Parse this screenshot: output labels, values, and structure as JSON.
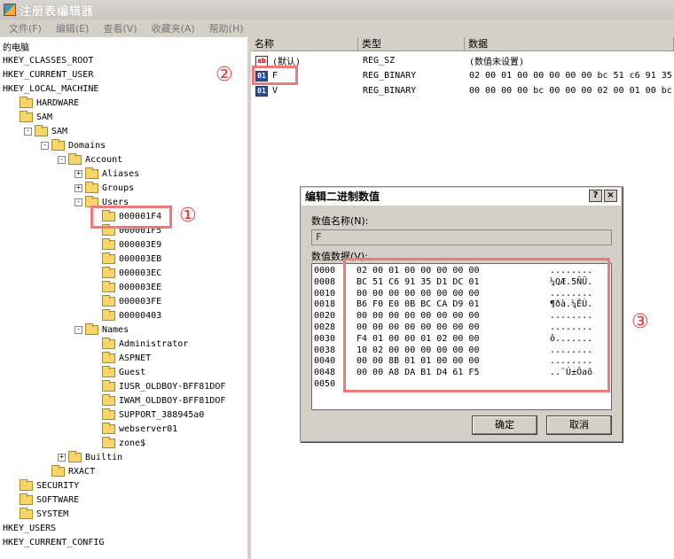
{
  "window": {
    "title": "注册表编辑器"
  },
  "menu": [
    "文件(F)",
    "编辑(E)",
    "查看(V)",
    "收藏夹(A)",
    "帮助(H)"
  ],
  "tree": [
    {
      "label": "的电脑",
      "level": 0,
      "exp": "",
      "icon": false
    },
    {
      "label": "HKEY_CLASSES_ROOT",
      "level": 0,
      "exp": "",
      "icon": false
    },
    {
      "label": "HKEY_CURRENT_USER",
      "level": 0,
      "exp": "",
      "icon": false
    },
    {
      "label": "HKEY_LOCAL_MACHINE",
      "level": 0,
      "exp": "",
      "icon": false
    },
    {
      "label": "HARDWARE",
      "level": 1,
      "exp": "",
      "icon": true
    },
    {
      "label": "SAM",
      "level": 1,
      "exp": "",
      "icon": true
    },
    {
      "label": "SAM",
      "level": 2,
      "exp": "-",
      "icon": true
    },
    {
      "label": "Domains",
      "level": 3,
      "exp": "-",
      "icon": true
    },
    {
      "label": "Account",
      "level": 4,
      "exp": "-",
      "icon": true
    },
    {
      "label": "Aliases",
      "level": 5,
      "exp": "+",
      "icon": true
    },
    {
      "label": "Groups",
      "level": 5,
      "exp": "+",
      "icon": true
    },
    {
      "label": "Users",
      "level": 5,
      "exp": "-",
      "icon": true
    },
    {
      "label": "000001F4",
      "level": 6,
      "exp": "",
      "icon": true
    },
    {
      "label": "000001F5",
      "level": 6,
      "exp": "",
      "icon": true
    },
    {
      "label": "000003E9",
      "level": 6,
      "exp": "",
      "icon": true
    },
    {
      "label": "000003EB",
      "level": 6,
      "exp": "",
      "icon": true
    },
    {
      "label": "000003EC",
      "level": 6,
      "exp": "",
      "icon": true
    },
    {
      "label": "000003EE",
      "level": 6,
      "exp": "",
      "icon": true
    },
    {
      "label": "000003FE",
      "level": 6,
      "exp": "",
      "icon": true
    },
    {
      "label": "00000403",
      "level": 6,
      "exp": "",
      "icon": true
    },
    {
      "label": "Names",
      "level": 5,
      "exp": "-",
      "icon": true
    },
    {
      "label": "Administrator",
      "level": 6,
      "exp": "",
      "icon": true
    },
    {
      "label": "ASPNET",
      "level": 6,
      "exp": "",
      "icon": true
    },
    {
      "label": "Guest",
      "level": 6,
      "exp": "",
      "icon": true
    },
    {
      "label": "IUSR_OLDBOY-BFF81DOF",
      "level": 6,
      "exp": "",
      "icon": true
    },
    {
      "label": "IWAM_OLDBOY-BFF81DOF",
      "level": 6,
      "exp": "",
      "icon": true
    },
    {
      "label": "SUPPORT_388945a0",
      "level": 6,
      "exp": "",
      "icon": true
    },
    {
      "label": "webserver01",
      "level": 6,
      "exp": "",
      "icon": true
    },
    {
      "label": "zone$",
      "level": 6,
      "exp": "",
      "icon": true
    },
    {
      "label": "Builtin",
      "level": 4,
      "exp": "+",
      "icon": true
    },
    {
      "label": "RXACT",
      "level": 3,
      "exp": "",
      "icon": true
    },
    {
      "label": "SECURITY",
      "level": 1,
      "exp": "",
      "icon": true
    },
    {
      "label": "SOFTWARE",
      "level": 1,
      "exp": "",
      "icon": true
    },
    {
      "label": "SYSTEM",
      "level": 1,
      "exp": "",
      "icon": true
    },
    {
      "label": "HKEY_USERS",
      "level": 0,
      "exp": "",
      "icon": false
    },
    {
      "label": "HKEY_CURRENT_CONFIG",
      "level": 0,
      "exp": "",
      "icon": false
    }
  ],
  "list": {
    "headers": [
      "名称",
      "类型",
      "数据"
    ],
    "rows": [
      {
        "icon": "ab",
        "name": "(默认)",
        "type": "REG_SZ",
        "data": "(数值未设置)"
      },
      {
        "icon": "bin",
        "name": "F",
        "type": "REG_BINARY",
        "data": "02 00 01 00 00 00 00 00 bc 51 c6 91 35"
      },
      {
        "icon": "bin",
        "name": "V",
        "type": "REG_BINARY",
        "data": "00 00 00 00 bc 00 00 00 02 00 01 00 bc"
      }
    ]
  },
  "annotations": [
    "①",
    "②",
    "③"
  ],
  "dialog": {
    "title": "编辑二进制数值",
    "help": "?",
    "close": "×",
    "name_label": "数值名称(N):",
    "name_value": "F",
    "data_label": "数值数据(V):",
    "rows": [
      {
        "off": "0000",
        "hex": "02 00 01 00 00 00 00 00",
        "ascii": "........"
      },
      {
        "off": "0008",
        "hex": "BC 51 C6 91 35 D1 DC 01",
        "ascii": "¼QÆ.5ÑÜ."
      },
      {
        "off": "0010",
        "hex": "00 00 00 00 00 00 00 00",
        "ascii": "........"
      },
      {
        "off": "0018",
        "hex": "B6 F0 E0 0B BC CA D9 01",
        "ascii": "¶ðà.¼ÊÙ."
      },
      {
        "off": "0020",
        "hex": "00 00 00 00 00 00 00 00",
        "ascii": "........"
      },
      {
        "off": "0028",
        "hex": "00 00 00 00 00 00 00 00",
        "ascii": "........"
      },
      {
        "off": "0030",
        "hex": "F4 01 00 00 01 02 00 00",
        "ascii": "ô......."
      },
      {
        "off": "0038",
        "hex": "10 02 00 00 00 00 00 00",
        "ascii": "........"
      },
      {
        "off": "0040",
        "hex": "00 00 8B 01 01 00 00 00",
        "ascii": "........"
      },
      {
        "off": "0048",
        "hex": "00 00 A8 DA B1 D4 61 F5",
        "ascii": "..¨Ú±Ôaõ"
      },
      {
        "off": "0050",
        "hex": "",
        "ascii": ""
      }
    ],
    "ok": "确定",
    "cancel": "取消"
  }
}
